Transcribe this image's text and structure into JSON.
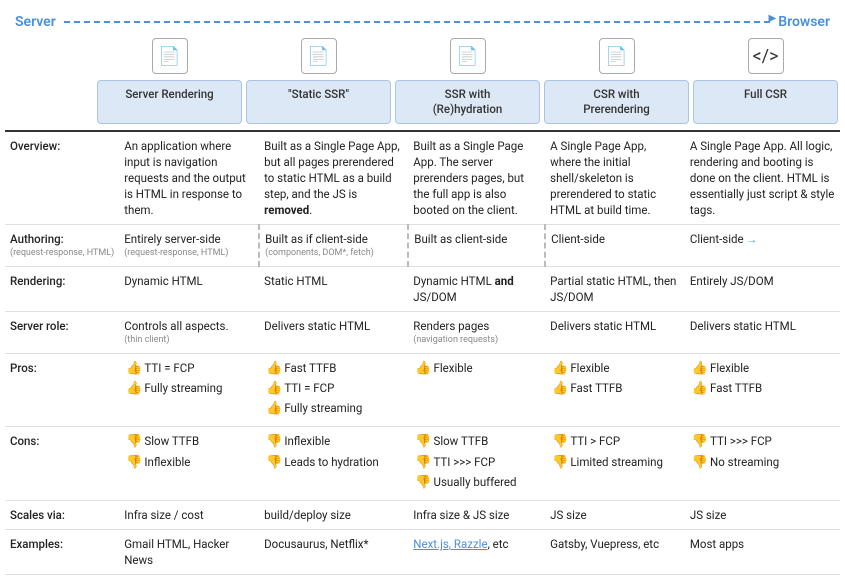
{
  "header": {
    "server_label": "Server",
    "browser_label": "Browser"
  },
  "columns": [
    {
      "id": "server-rendering",
      "label": "Server Rendering",
      "icon": "📄"
    },
    {
      "id": "static-ssr",
      "label": "\"Static SSR\"",
      "icon": "📄"
    },
    {
      "id": "ssr-rehydration",
      "label": "SSR with\n(Re)hydration",
      "icon": "📄"
    },
    {
      "id": "csr-prerendering",
      "label": "CSR with\nPrerendering",
      "icon": "📄"
    },
    {
      "id": "full-csr",
      "label": "Full CSR",
      "icon": "</>"
    }
  ],
  "rows": [
    {
      "label": "Overview:",
      "sub_label": "",
      "cells": [
        "An application where input is navigation requests and the output is HTML in response to them.",
        "Built as a Single Page App, but all pages prerendered to static HTML as a build step, and the JS is removed.",
        "Built as a Single Page App. The server prerenders pages, but the full app is also booted on the client.",
        "A Single Page App, where the initial shell/skeleton is prerendered to static HTML at build time.",
        "A Single Page App. All logic, rendering and booting is done on the client. HTML is essentially just script & style tags."
      ]
    },
    {
      "label": "Authoring:",
      "sub_label": "(request-response, HTML)",
      "cells": [
        {
          "text": "Entirely server-side",
          "sub": "(request-response, HTML)"
        },
        {
          "text": "Built as if client-side",
          "sub": "(components, DOM*, fetch)",
          "dashed": true
        },
        {
          "text": "Built as client-side",
          "sub": "",
          "dashed": true
        },
        {
          "text": "Client-side",
          "sub": ""
        },
        {
          "text": "Client-side",
          "sub": "",
          "arrow": true
        }
      ]
    },
    {
      "label": "Rendering:",
      "sub_label": "",
      "cells": [
        "Dynamic HTML",
        "Static HTML",
        "Dynamic HTML and JS/DOM",
        "Partial static HTML, then JS/DOM",
        "Entirely JS/DOM"
      ]
    },
    {
      "label": "Server role:",
      "sub_label": "",
      "cells": [
        {
          "text": "Controls all aspects.",
          "sub": "(thin client)"
        },
        {
          "text": "Delivers static HTML",
          "sub": ""
        },
        {
          "text": "Renders pages",
          "sub": "(navigation requests)"
        },
        {
          "text": "Delivers static HTML",
          "sub": ""
        },
        {
          "text": "Delivers static HTML",
          "sub": ""
        }
      ]
    },
    {
      "label": "Pros:",
      "sub_label": "",
      "cells": [
        [
          {
            "emoji": "👍",
            "text": "TTI = FCP"
          },
          {
            "emoji": "👍",
            "text": "Fully streaming"
          }
        ],
        [
          {
            "emoji": "👍",
            "text": "Fast TTFB"
          },
          {
            "emoji": "👍",
            "text": "TTI = FCP"
          },
          {
            "emoji": "👍",
            "text": "Fully streaming"
          }
        ],
        [
          {
            "emoji": "👍",
            "text": "Flexible"
          }
        ],
        [
          {
            "emoji": "👍",
            "text": "Flexible"
          },
          {
            "emoji": "👍",
            "text": "Fast TTFB"
          }
        ],
        [
          {
            "emoji": "👍",
            "text": "Flexible"
          },
          {
            "emoji": "👍",
            "text": "Fast TTFB"
          }
        ]
      ]
    },
    {
      "label": "Cons:",
      "sub_label": "",
      "cells": [
        [
          {
            "emoji": "👎",
            "text": "Slow TTFB"
          },
          {
            "emoji": "👎",
            "text": "Inflexible"
          }
        ],
        [
          {
            "emoji": "👎",
            "text": "Inflexible"
          },
          {
            "emoji": "👎",
            "text": "Leads to hydration"
          }
        ],
        [
          {
            "emoji": "👎",
            "text": "Slow TTFB"
          },
          {
            "emoji": "👎",
            "text": "TTI >>> FCP"
          },
          {
            "emoji": "👎",
            "text": "Usually buffered"
          }
        ],
        [
          {
            "emoji": "👎",
            "text": "TTI > FCP"
          },
          {
            "emoji": "👎",
            "text": "Limited streaming"
          }
        ],
        [
          {
            "emoji": "👎",
            "text": "TTI >>> FCP"
          },
          {
            "emoji": "👎",
            "text": "No streaming"
          }
        ]
      ]
    },
    {
      "label": "Scales via:",
      "sub_label": "",
      "cells": [
        "Infra size / cost",
        "build/deploy size",
        "Infra size & JS size",
        "JS size",
        "JS size"
      ]
    },
    {
      "label": "Examples:",
      "sub_label": "",
      "cells": [
        "Gmail HTML, Hacker News",
        "Docusaurus, Netflix*",
        {
          "text": "Next.js, Razzle",
          "sub": ", etc",
          "linked": "Next.js, Razzle"
        },
        "Gatsby, Vuepress, etc",
        "Most apps"
      ]
    }
  ]
}
